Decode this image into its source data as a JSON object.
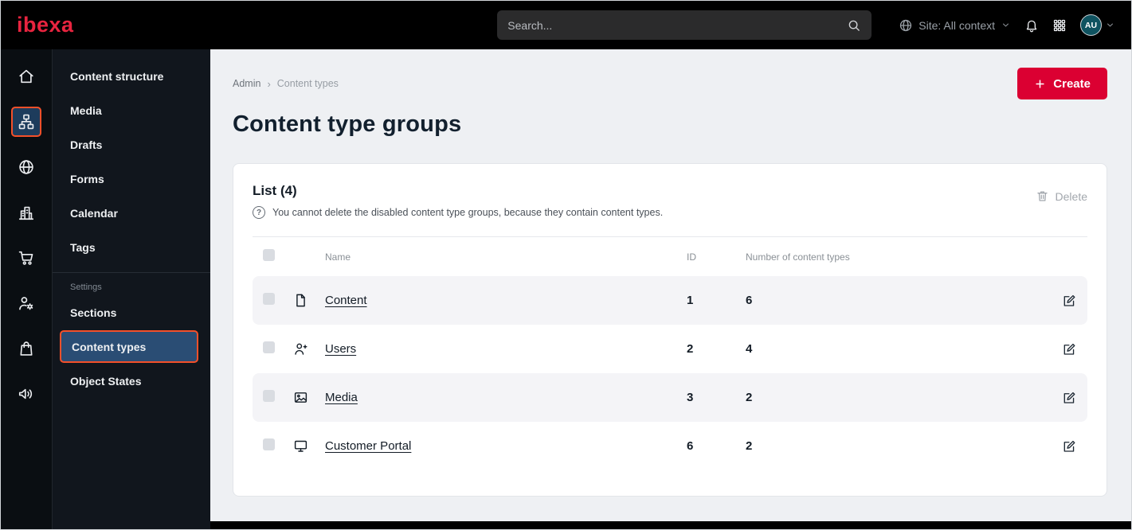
{
  "topbar": {
    "logo": "ibexa",
    "search_placeholder": "Search...",
    "site_context": "Site: All context",
    "avatar_initials": "AU"
  },
  "sidebar": {
    "rail_items": [
      {
        "icon": "home-icon",
        "active": false
      },
      {
        "icon": "content-tree-icon",
        "active": true
      },
      {
        "icon": "globe-icon",
        "active": false
      },
      {
        "icon": "building-icon",
        "active": false
      },
      {
        "icon": "cart-icon",
        "active": false
      },
      {
        "icon": "user-settings-icon",
        "active": false
      },
      {
        "icon": "product-bag-icon",
        "active": false
      },
      {
        "icon": "megaphone-icon",
        "active": false
      }
    ],
    "menu_items": [
      {
        "label": "Content structure"
      },
      {
        "label": "Media"
      },
      {
        "label": "Drafts"
      },
      {
        "label": "Forms"
      },
      {
        "label": "Calendar"
      },
      {
        "label": "Tags"
      }
    ],
    "settings_header": "Settings",
    "settings_items": [
      {
        "label": "Sections",
        "active": false
      },
      {
        "label": "Content types",
        "active": true
      },
      {
        "label": "Object States",
        "active": false
      }
    ]
  },
  "main": {
    "breadcrumb": {
      "root": "Admin",
      "separator": "›",
      "current": "Content types"
    },
    "create_button": "Create",
    "page_title": "Content type groups",
    "card": {
      "list_title": "List (4)",
      "help_icon": "?",
      "help_text": "You cannot delete the disabled content type groups, because they contain content types.",
      "delete_button": "Delete",
      "table": {
        "headers": {
          "name": "Name",
          "id": "ID",
          "count": "Number of content types"
        },
        "rows": [
          {
            "name": "Content",
            "icon": "file-icon",
            "id": "1",
            "count": "6"
          },
          {
            "name": "Users",
            "icon": "user-icon",
            "id": "2",
            "count": "4"
          },
          {
            "name": "Media",
            "icon": "image-icon",
            "id": "3",
            "count": "2"
          },
          {
            "name": "Customer Portal",
            "icon": "monitor-icon",
            "id": "6",
            "count": "2"
          }
        ]
      }
    }
  },
  "colors": {
    "brand_red": "#db0032",
    "logo_red": "#e8243f",
    "accent_orange": "#f4502a",
    "active_blue": "#2a4d74",
    "dark_navy": "#131c26",
    "content_bg": "#eef0f3",
    "row_alt_bg": "#f4f4f7"
  }
}
